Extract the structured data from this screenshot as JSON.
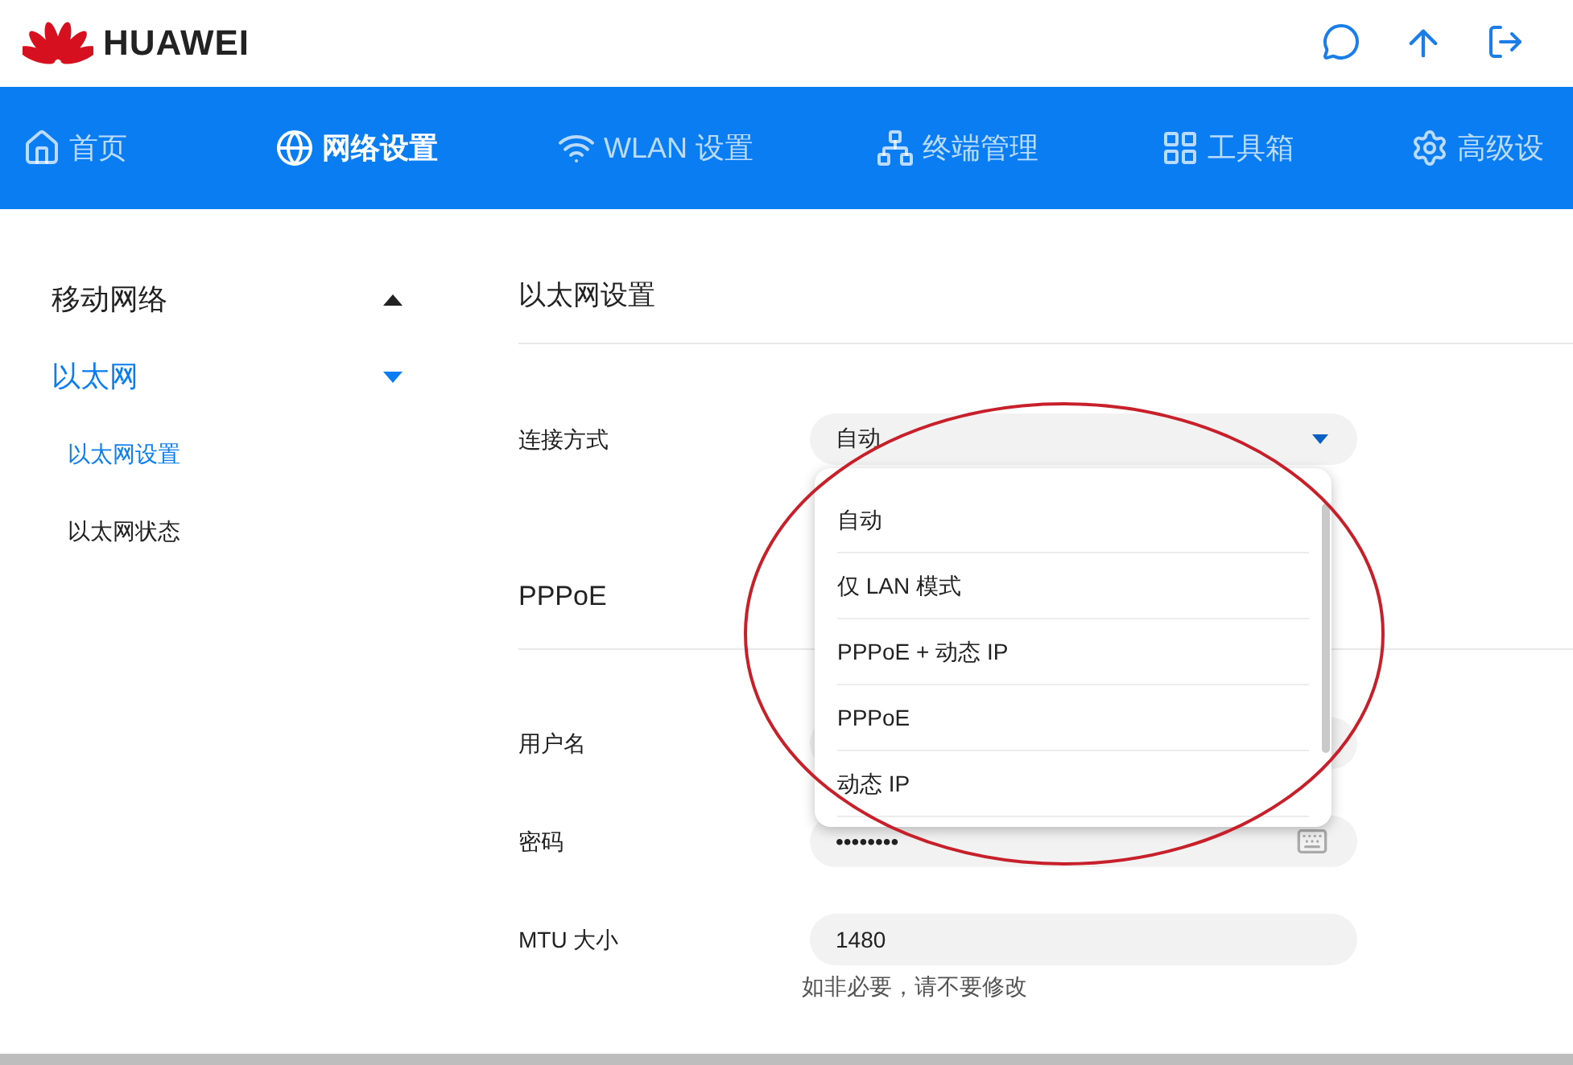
{
  "brand": {
    "name": "HUAWEI"
  },
  "nav": [
    {
      "label": "首页",
      "selected": false
    },
    {
      "label": "网络设置",
      "selected": true
    },
    {
      "label": "WLAN 设置",
      "selected": false
    },
    {
      "label": "终端管理",
      "selected": false
    },
    {
      "label": "工具箱",
      "selected": false
    },
    {
      "label": "高级设",
      "selected": false
    }
  ],
  "sidebar": [
    {
      "label": "移动网络",
      "expanded": false,
      "selected": false
    },
    {
      "label": "以太网",
      "expanded": true,
      "selected": true,
      "children": [
        {
          "label": "以太网设置",
          "selected": true
        },
        {
          "label": "以太网状态",
          "selected": false
        }
      ]
    }
  ],
  "content": {
    "title": "以太网设置",
    "connection": {
      "label": "连接方式",
      "value": "自动",
      "open": true,
      "options": [
        "自动",
        "仅 LAN 模式",
        "PPPoE + 动态 IP",
        "PPPoE",
        "动态 IP"
      ]
    },
    "pppoe": {
      "title": "PPPoE",
      "fields": [
        {
          "label": "用户名",
          "kind": "text"
        },
        {
          "label": "密码",
          "kind": "password",
          "value": "••••••••"
        },
        {
          "label": "MTU 大小",
          "kind": "text",
          "value": "1480",
          "hint": "如非必要，请不要修改"
        }
      ]
    }
  }
}
